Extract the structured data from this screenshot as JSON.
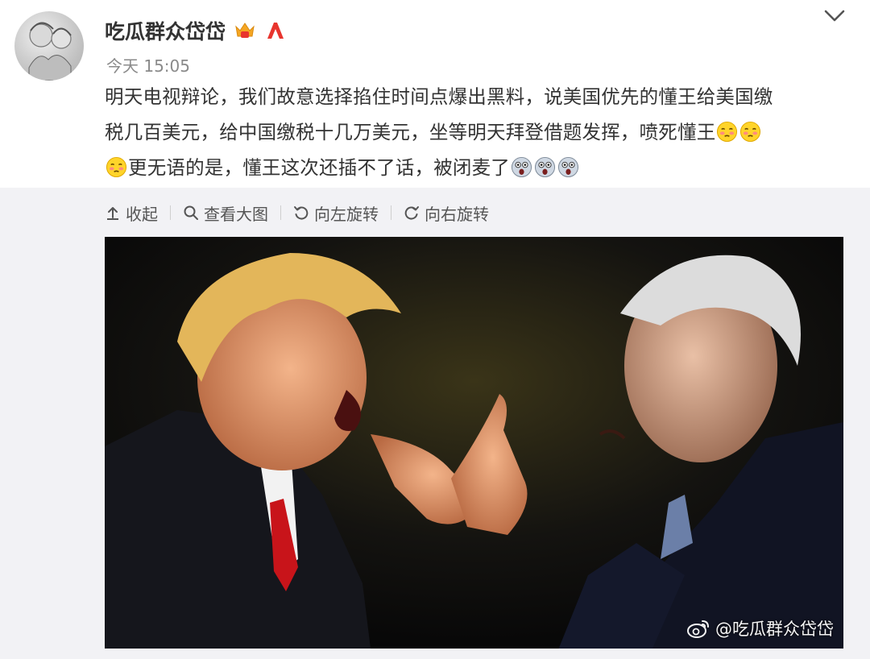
{
  "post": {
    "author": "吃瓜群众岱岱",
    "time": "今天 15:05",
    "text_lines": [
      "明天电视辩论，我们故意选择掐住时间点爆出黑料，说美国优先的懂王给美国缴",
      "税几百美元，给中国缴税十几万美元，坐等明天拜登借题发挥，喷死懂王",
      "更无语的是，懂王这次还插不了话，被闭麦了"
    ],
    "emoji_names": [
      "shy-face-emoji",
      "shocked-face-emoji"
    ]
  },
  "toolbar": {
    "collapse": "收起",
    "view_large": "查看大图",
    "rotate_left": "向左旋转",
    "rotate_right": "向右旋转"
  },
  "image": {
    "watermark": "@吃瓜群众岱岱"
  },
  "icons": {
    "expand": "chevron-down-icon",
    "collapse": "arrow-up-icon",
    "view": "search-icon",
    "rotate_left": "rotate-left-icon",
    "rotate_right": "rotate-right-icon",
    "weibo": "weibo-logo-icon"
  },
  "colors": {
    "badge_crown": "#f5a623",
    "badge_red": "#e8352e",
    "toolbar_bg": "#f2f2f5",
    "text": "#333333",
    "muted": "#8a8a8a"
  }
}
